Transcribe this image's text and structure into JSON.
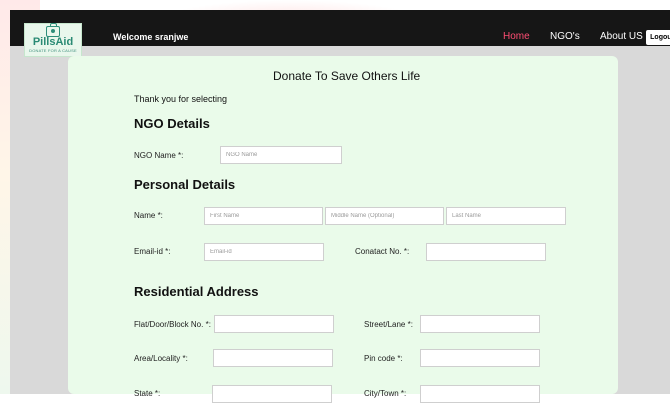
{
  "navbar": {
    "logo_name": "PillsAid",
    "logo_tagline": "DONATE FOR A CAUSE",
    "welcome": "Welcome sranjwe",
    "links": [
      {
        "label": "Home",
        "active": true
      },
      {
        "label": "NGO's",
        "active": false
      },
      {
        "label": "About US",
        "active": false
      }
    ],
    "logout_label": "Logout",
    "active_color": "#ff4d73"
  },
  "form": {
    "title": "Donate To Save Others Life",
    "thank_you": "Thank you for selecting",
    "ngo_section": {
      "heading": "NGO Details",
      "ngo_name_label": "NGO Name *:",
      "ngo_name_placeholder": "NGO Name"
    },
    "personal_section": {
      "heading": "Personal Details",
      "name_label": "Name *:",
      "first_name_placeholder": "First Name",
      "middle_name_placeholder": "Middle Name (Optional)",
      "last_name_placeholder": "Last Name",
      "email_label": "Email-id *:",
      "email_placeholder": "Email-id",
      "contact_label": "Conatact No. *:",
      "contact_placeholder": ""
    },
    "address_section": {
      "heading": "Residential Address",
      "flat_label": "Flat/Door/Block No. *:",
      "street_label": "Street/Lane *:",
      "area_label": "Area/Locality *:",
      "pincode_label": "Pin code *:",
      "state_label": "State *:",
      "city_label": "City/Town *:"
    }
  }
}
